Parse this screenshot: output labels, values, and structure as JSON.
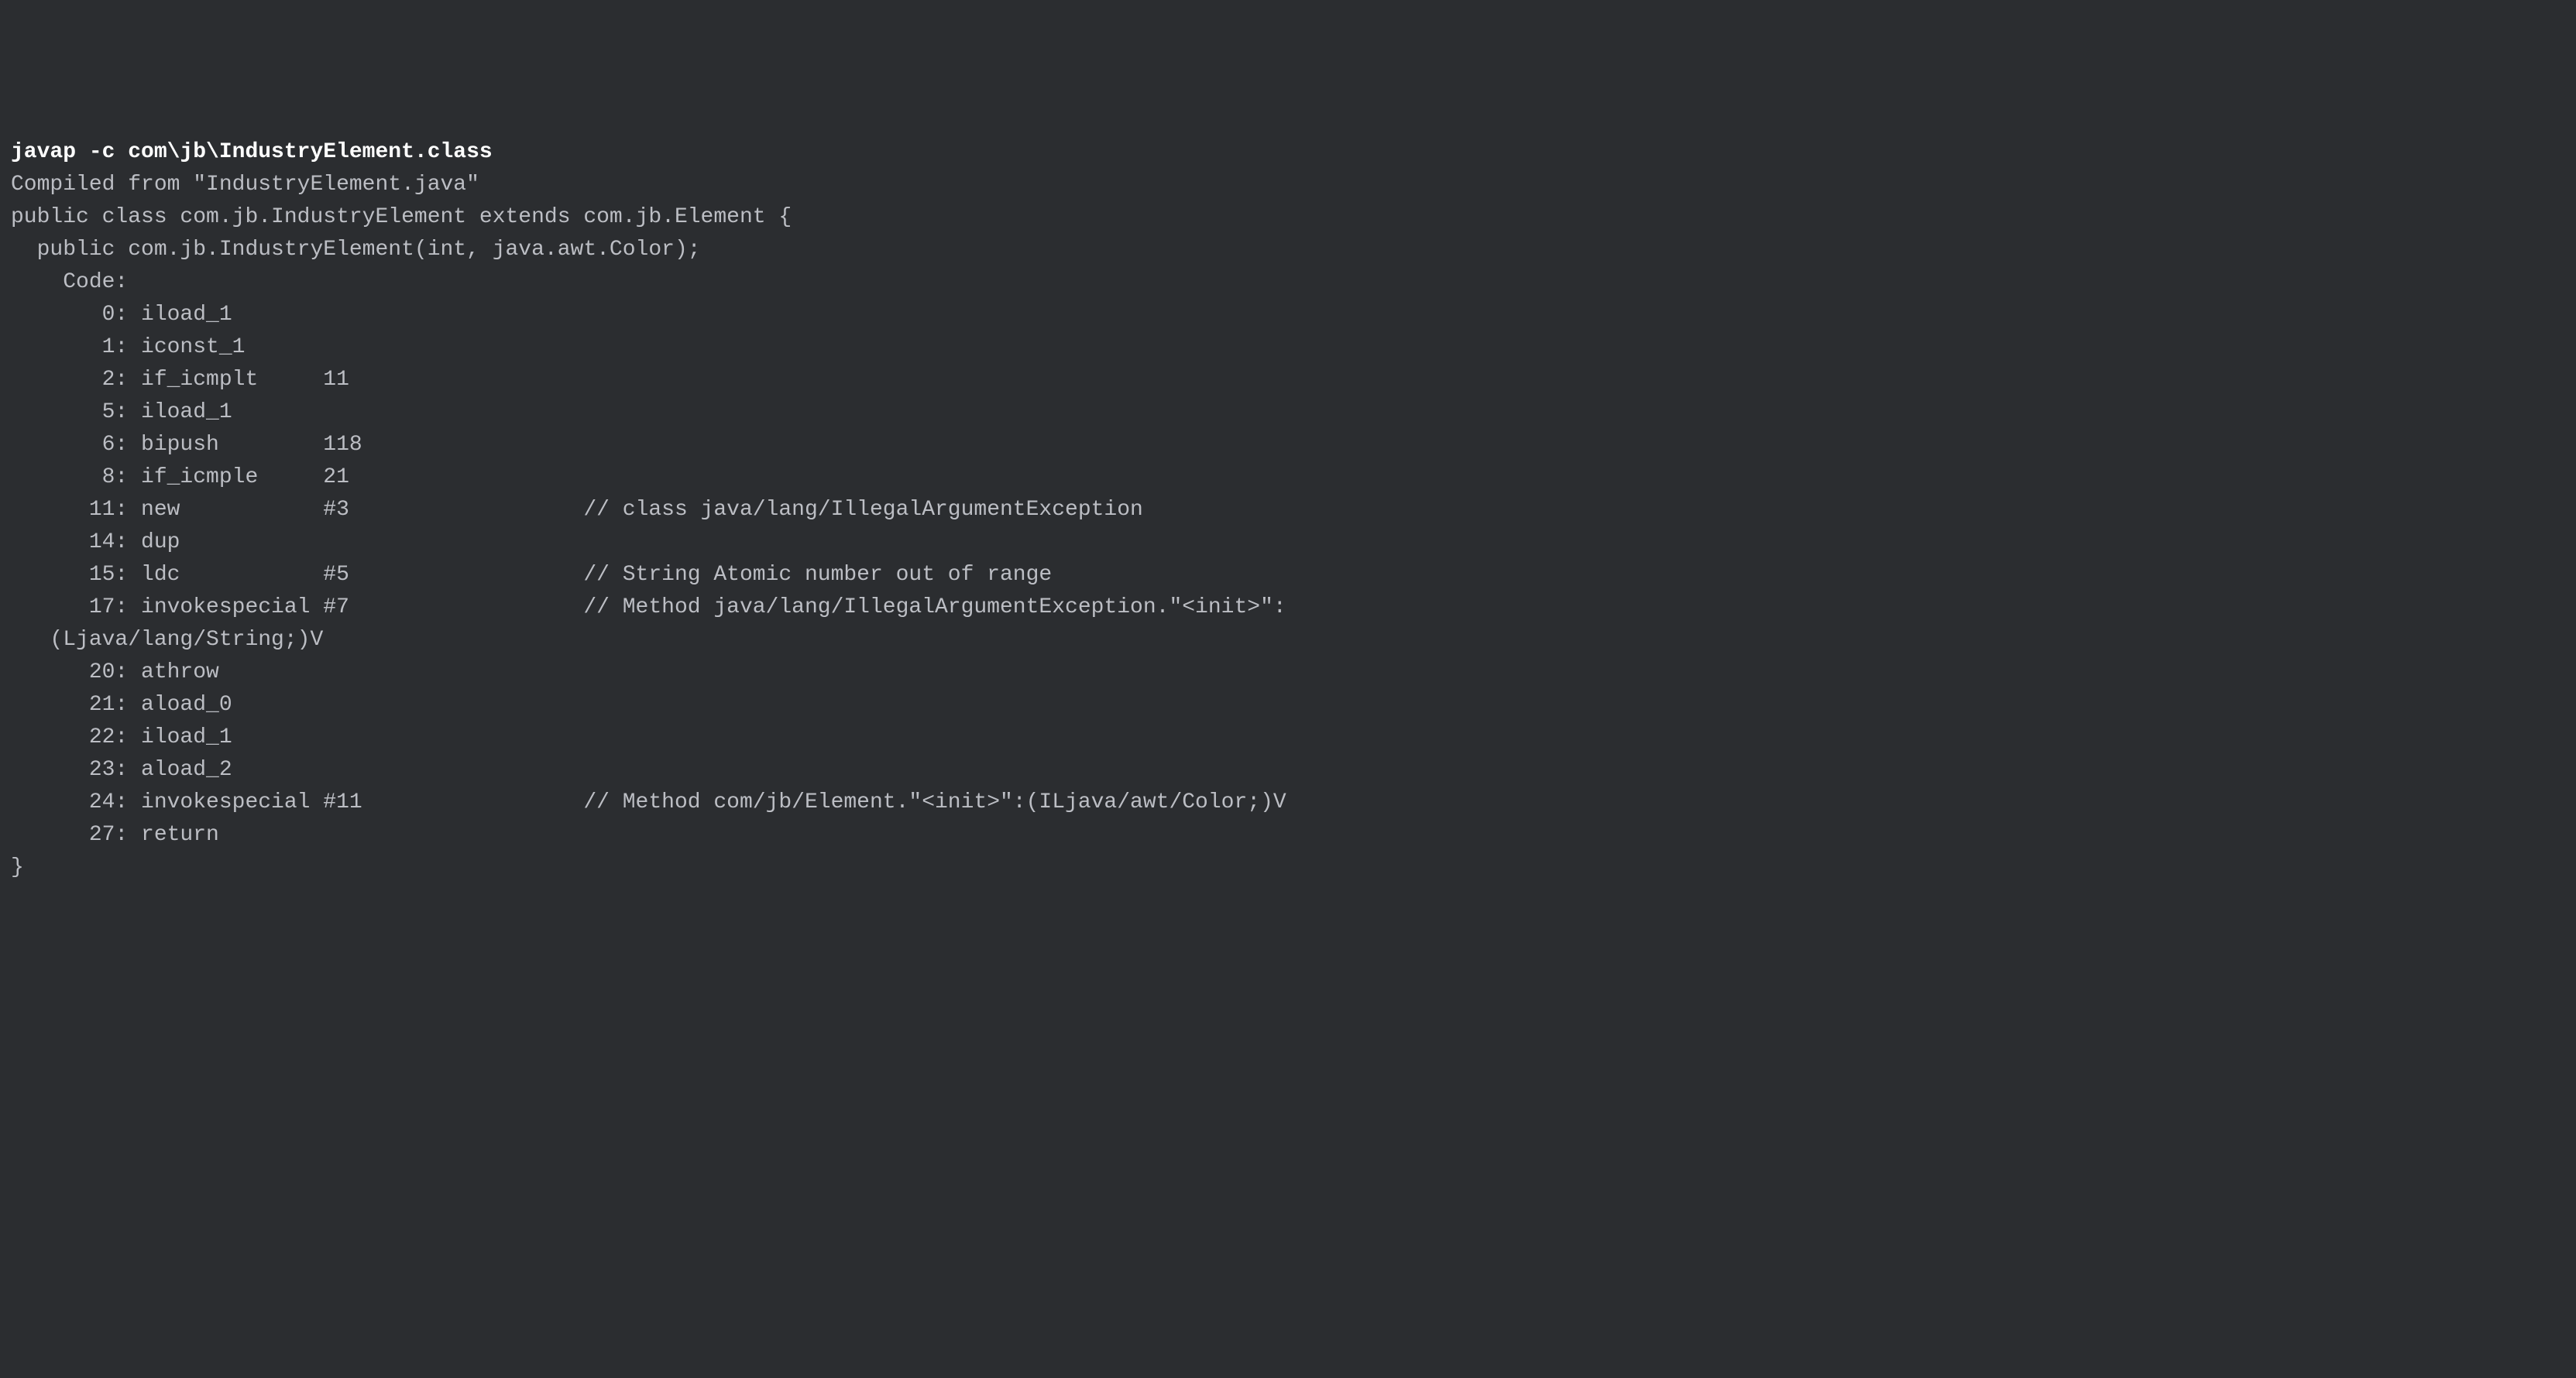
{
  "terminal": {
    "command": "javap -c com\\jb\\IndustryElement.class",
    "output": "Compiled from \"IndustryElement.java\"\npublic class com.jb.IndustryElement extends com.jb.Element {\n  public com.jb.IndustryElement(int, java.awt.Color);\n    Code:\n       0: iload_1\n       1: iconst_1\n       2: if_icmplt     11\n       5: iload_1\n       6: bipush        118\n       8: if_icmple     21\n      11: new           #3                  // class java/lang/IllegalArgumentException\n      14: dup\n      15: ldc           #5                  // String Atomic number out of range\n      17: invokespecial #7                  // Method java/lang/IllegalArgumentException.\"<init>\":\n   (Ljava/lang/String;)V\n      20: athrow\n      21: aload_0\n      22: iload_1\n      23: aload_2\n      24: invokespecial #11                 // Method com/jb/Element.\"<init>\":(ILjava/awt/Color;)V\n      27: return\n}"
  }
}
